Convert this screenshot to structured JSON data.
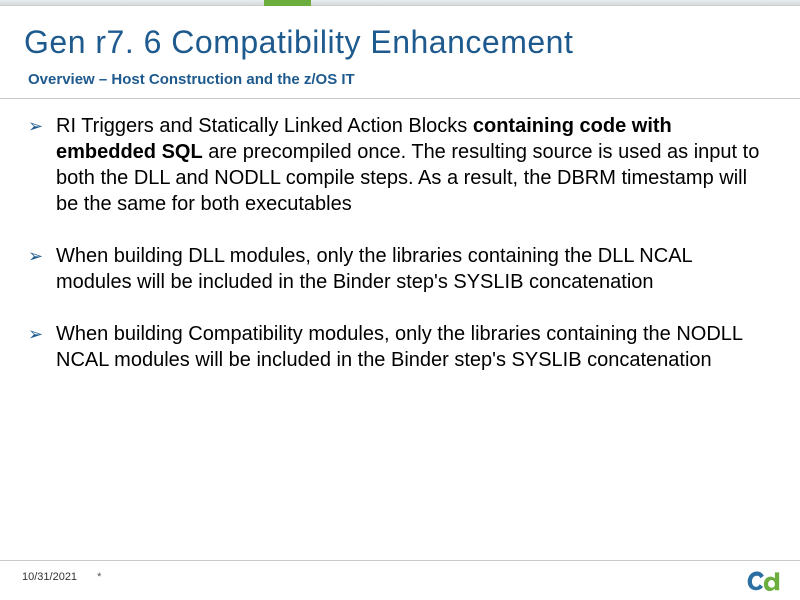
{
  "title": "Gen r7. 6 Compatibility Enhancement",
  "subtitle": "Overview – Host Construction and the z/OS IT",
  "bullets": [
    {
      "prefix": "RI Triggers and Statically Linked Action Blocks ",
      "bold": "containing code with embedded SQL",
      "suffix": " are precompiled once. The resulting source is used as input to both the DLL and NODLL compile steps. As a result, the DBRM timestamp will be the same for both executables"
    },
    {
      "prefix": "When building DLL modules, only the libraries containing the DLL NCAL modules will be included in the Binder step's SYSLIB concatenation",
      "bold": "",
      "suffix": ""
    },
    {
      "prefix": "When building Compatibility modules, only the libraries containing the NODLL NCAL modules will be included in the Binder step's SYSLIB concatenation",
      "bold": "",
      "suffix": ""
    }
  ],
  "footer": {
    "date": "10/31/2021",
    "marker": "*"
  },
  "arrow_glyph": "➢"
}
